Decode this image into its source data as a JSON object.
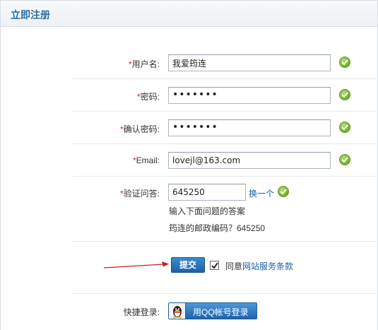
{
  "header": {
    "title": "立即注册"
  },
  "form": {
    "required_mark": "*",
    "username": {
      "label": "用户名:",
      "value": "我爱筠连"
    },
    "password": {
      "label": "密码:",
      "value": "•••••••"
    },
    "confirm_password": {
      "label": "确认密码:",
      "value": "•••••••"
    },
    "email": {
      "label": "Email:",
      "value": "lovejl@163.com"
    },
    "verify": {
      "label": "验证问答:",
      "value": "645250",
      "change_label": "换一个",
      "hint": "输入下面问题的答案",
      "question": "筠连的邮政编码？645250"
    },
    "submit_label": "提交",
    "agree_prefix": "同意",
    "agree_link": "网站服务条款",
    "agree_checked": true
  },
  "quick_login": {
    "label": "快捷登录:",
    "qq_button_label": "用QQ帐号登录"
  },
  "colors": {
    "accent": "#2b6ea3",
    "link": "#1a5fa7",
    "required": "#e0261d",
    "ok": "#6fae28"
  }
}
